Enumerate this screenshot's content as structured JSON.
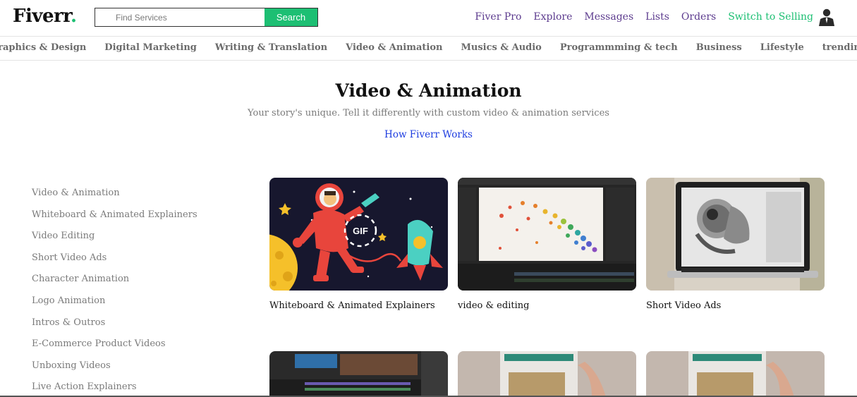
{
  "header": {
    "logo_text": "Fiverr",
    "logo_dot": ".",
    "search_placeholder": "Find Services",
    "search_button": "Search",
    "nav": [
      "Fiver Pro",
      "Explore",
      "Messages",
      "Lists",
      "Orders",
      "Switch to Selling"
    ],
    "brand_color": "#1dbf73",
    "nav_color": "#5c3b8e"
  },
  "categories": [
    "Graphics & Design",
    "Digital Marketing",
    "Writing & Translation",
    "Video & Animation",
    "Musics & Audio",
    "Programmming & tech",
    "Business",
    "Lifestyle",
    "trending"
  ],
  "hero": {
    "title": "Video & Animation",
    "subtitle": "Your story's unique. Tell it differently with custom video & animation services",
    "link": "How Fiverr Works"
  },
  "sidebar": [
    "Video & Animation",
    "Whiteboard & Animated Explainers",
    "Video Editing",
    "Short Video Ads",
    "Character Animation",
    "Logo Animation",
    "Intros & Outros",
    "E-Commerce Product Videos",
    "Unboxing Videos",
    "Live Action Explainers"
  ],
  "cards": [
    {
      "label": "Whiteboard & Animated Explainers",
      "image_badge": "GIF"
    },
    {
      "label": "video & editing"
    },
    {
      "label": "Short Video Ads"
    },
    {
      "label": ""
    },
    {
      "label": ""
    },
    {
      "label": ""
    }
  ]
}
